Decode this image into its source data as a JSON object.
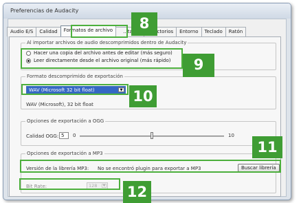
{
  "window": {
    "title": "Preferencias de Audacity"
  },
  "tabs": [
    {
      "label": "Audio E/S"
    },
    {
      "label": "Calidad"
    },
    {
      "label": "Formatos de archivo"
    },
    {
      "label": "...tanas"
    },
    {
      "label": "Directorios"
    },
    {
      "label": "Entorno"
    },
    {
      "label": "Teclado"
    },
    {
      "label": "Ratón"
    }
  ],
  "import_group": {
    "title": "Al importar archivos de audio descomprimidos dentro de Audacity",
    "option_copy": "Hacer una copia del archivo antes de editar (más seguro)",
    "option_direct": "Leer directamente desde el archivo original (más rápido)"
  },
  "export_format_group": {
    "title": "Formato descomprimido de exportación",
    "selected": "WAV (Microsoft 32 bit float)",
    "description": "WAV (Microsoft), 32 bit float"
  },
  "ogg_group": {
    "title": "Opciones de exportación a OGG",
    "quality_label": "Calidad OGG:",
    "quality_value": "5",
    "slider_min": "0",
    "slider_max": "10",
    "slider_level": 0.5
  },
  "mp3_group": {
    "title": "Opciones de exportación a MP3",
    "library_label": "Versión de la librería MP3:",
    "library_status": "No se encontró plugin para exportar a MP3",
    "find_button": "Buscar librería",
    "bitrate_label": "Bit Rate:",
    "bitrate_value": "128"
  },
  "callouts": [
    "8",
    "9",
    "10",
    "11",
    "12"
  ],
  "colors": {
    "callout": "#3f9d34",
    "highlight": "#4caf3c",
    "selection": "#3467c4"
  }
}
